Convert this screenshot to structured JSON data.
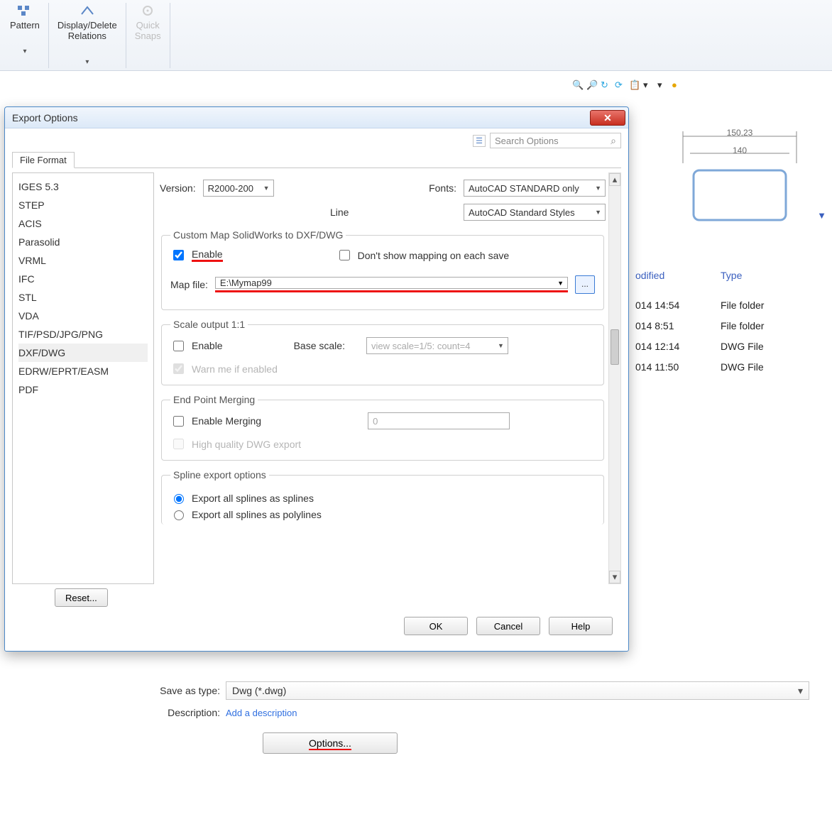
{
  "ribbon": {
    "pattern_label": "Pattern",
    "relations_label": "Display/Delete\nRelations",
    "snaps_label": "Quick\nSnaps"
  },
  "drawing": {
    "dim1": "150,23",
    "dim2": "140"
  },
  "bg_headers": {
    "modified": "odified",
    "type": "Type"
  },
  "bg_rows": [
    {
      "date": "014 14:54",
      "type": "File folder"
    },
    {
      "date": "014 8:51",
      "type": "File folder"
    },
    {
      "date": "014 12:14",
      "type": "DWG File"
    },
    {
      "date": "014 11:50",
      "type": "DWG File"
    }
  ],
  "dialog": {
    "title": "Export Options",
    "search_placeholder": "Search Options",
    "tab": "File Format",
    "formats": [
      "IGES 5.3",
      "STEP",
      "ACIS",
      "Parasolid",
      "VRML",
      "IFC",
      "STL",
      "VDA",
      "TIF/PSD/JPG/PNG",
      "DXF/DWG",
      "EDRW/EPRT/EASM",
      "PDF"
    ],
    "selected_format_index": 9,
    "version_label": "Version:",
    "version_value": "R2000-200",
    "fonts_label": "Fonts:",
    "fonts_value": "AutoCAD STANDARD only",
    "line_label": "Line",
    "line_value": "AutoCAD Standard Styles",
    "group_map": {
      "legend": "Custom Map SolidWorks to DXF/DWG",
      "enable": "Enable",
      "dontshow": "Don't show mapping on each save",
      "mapfile_label": "Map file:",
      "mapfile_value": "E:\\Mymap99",
      "browse": "..."
    },
    "group_scale": {
      "legend": "Scale output 1:1",
      "enable": "Enable",
      "basescale_label": "Base scale:",
      "basescale_value": "view scale=1/5: count=4",
      "warn": "Warn me if enabled"
    },
    "group_merge": {
      "legend": "End Point Merging",
      "enable": "Enable Merging",
      "value": "0",
      "hq": "High quality DWG export"
    },
    "group_spline": {
      "legend": "Spline export options",
      "opt1": "Export all splines as splines",
      "opt2": "Export all splines as polylines"
    },
    "reset": "Reset...",
    "ok": "OK",
    "cancel": "Cancel",
    "help": "Help"
  },
  "saveas": {
    "type_label": "Save as type:",
    "type_value": "Dwg (*.dwg)",
    "desc_label": "Description:",
    "desc_value": "Add a description",
    "options": "Options..."
  }
}
